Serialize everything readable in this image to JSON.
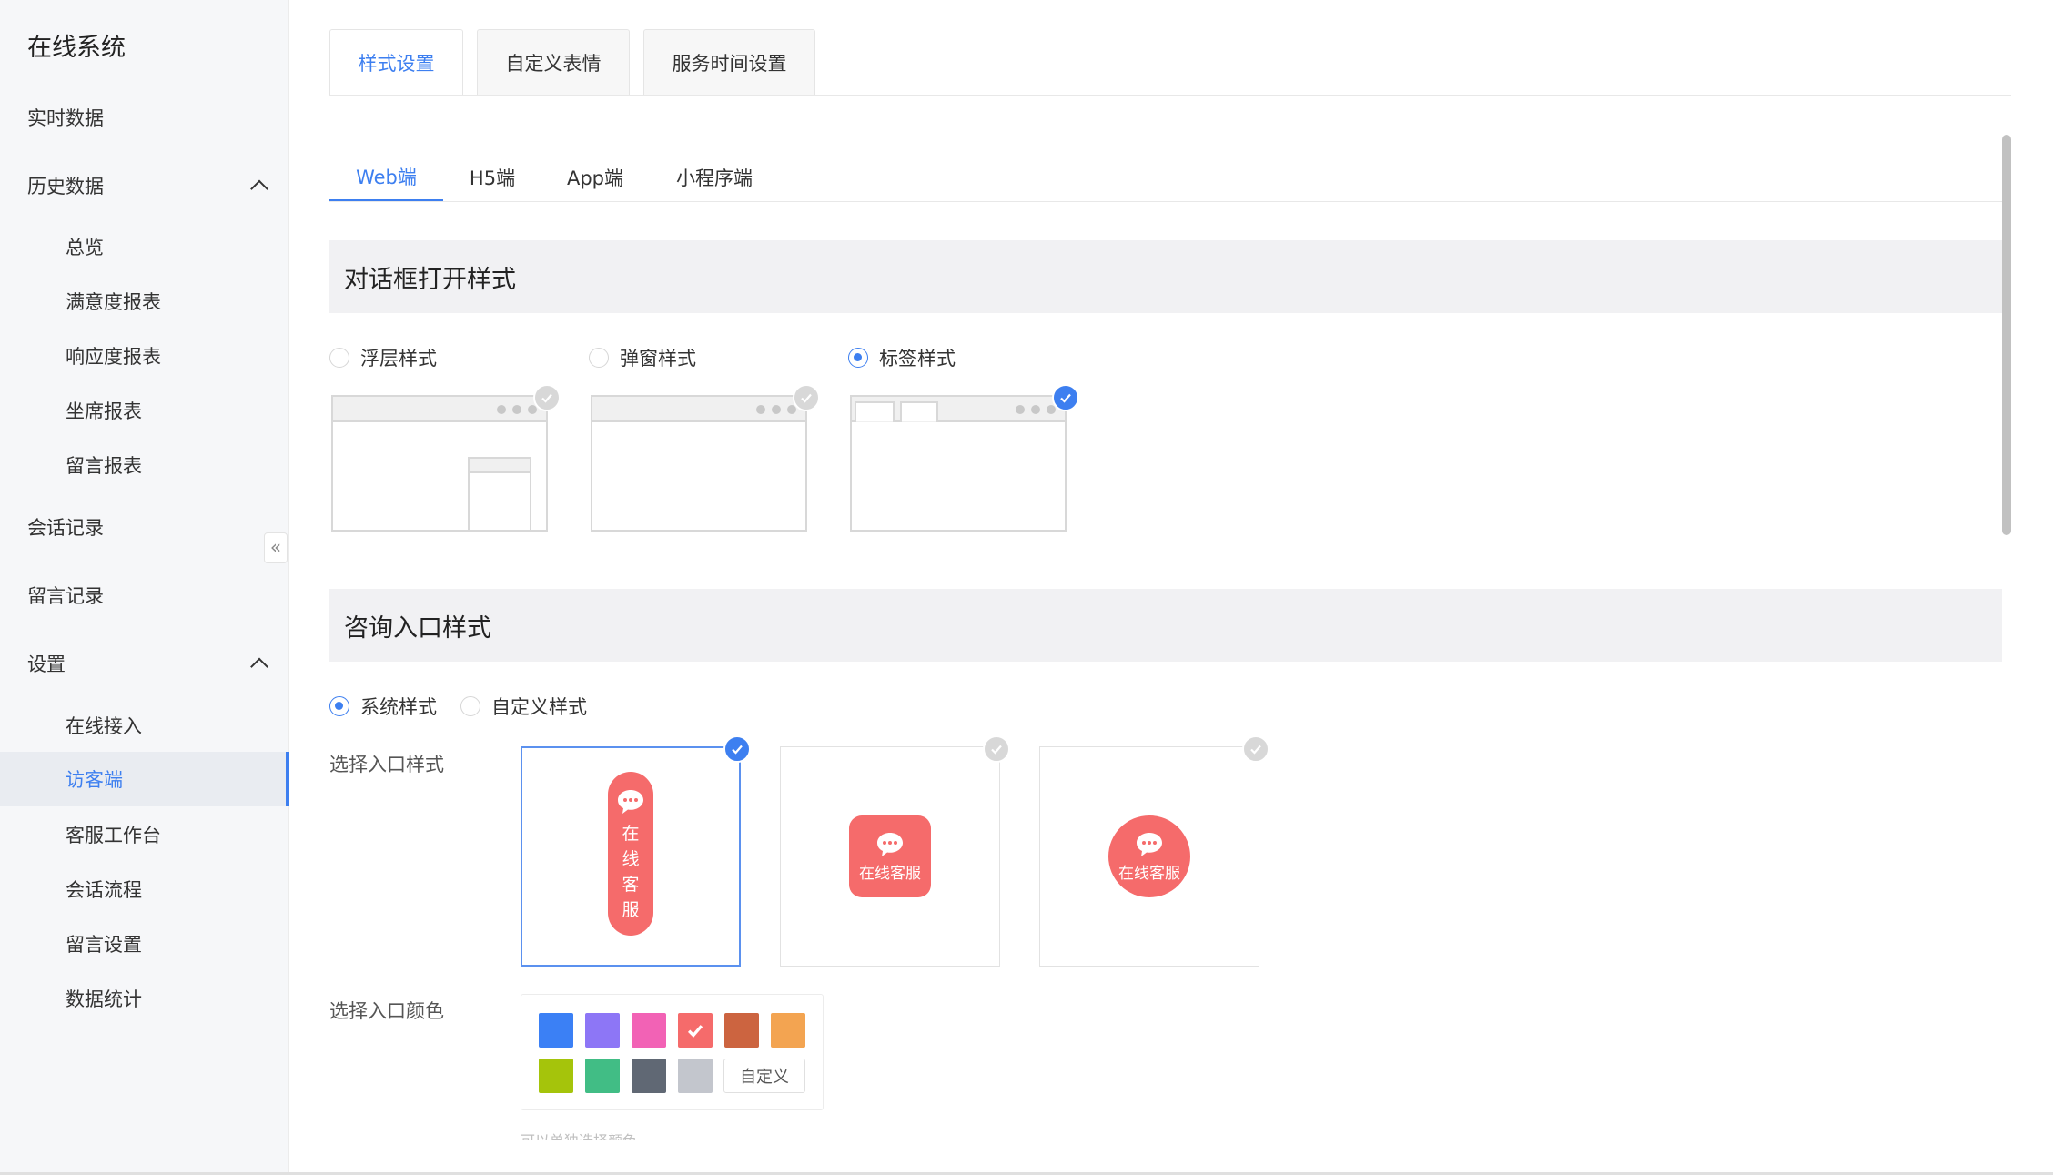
{
  "sidebar": {
    "title": "在线系统",
    "realtime": "实时数据",
    "history": "历史数据",
    "history_items": [
      "总览",
      "满意度报表",
      "响应度报表",
      "坐席报表",
      "留言报表"
    ],
    "sessions": "会话记录",
    "messages": "留言记录",
    "settings": "设置",
    "settings_items": [
      "在线接入",
      "访客端",
      "客服工作台",
      "会话流程",
      "留言设置",
      "数据统计"
    ],
    "active_item": "访客端",
    "collapse_glyph": "«"
  },
  "top_tabs": [
    "样式设置",
    "自定义表情",
    "服务时间设置"
  ],
  "sub_tabs": [
    "Web端",
    "H5端",
    "App端",
    "小程序端"
  ],
  "dialog_section": {
    "title": "对话框打开样式",
    "options": [
      "浮层样式",
      "弹窗样式",
      "标签样式"
    ],
    "selected": "标签样式"
  },
  "entry_section": {
    "title": "咨询入口样式",
    "options": [
      "系统样式",
      "自定义样式"
    ],
    "selected": "系统样式",
    "style_label": "选择入口样式",
    "button_vertical_text": "在线客服",
    "button_text": "在线客服",
    "color_label": "选择入口颜色",
    "custom_color": "自定义",
    "colors": [
      "#3b80f5",
      "#8d76f6",
      "#f262b5",
      "#f56b6b",
      "#cc6440",
      "#f3a451",
      "#a5c40b",
      "#41bd85",
      "#606874",
      "#c3c6cd"
    ],
    "selected_color": "#f56b6b",
    "faded_hint": "可以单独选择颜色"
  },
  "accent_color": "#3d7ff0"
}
